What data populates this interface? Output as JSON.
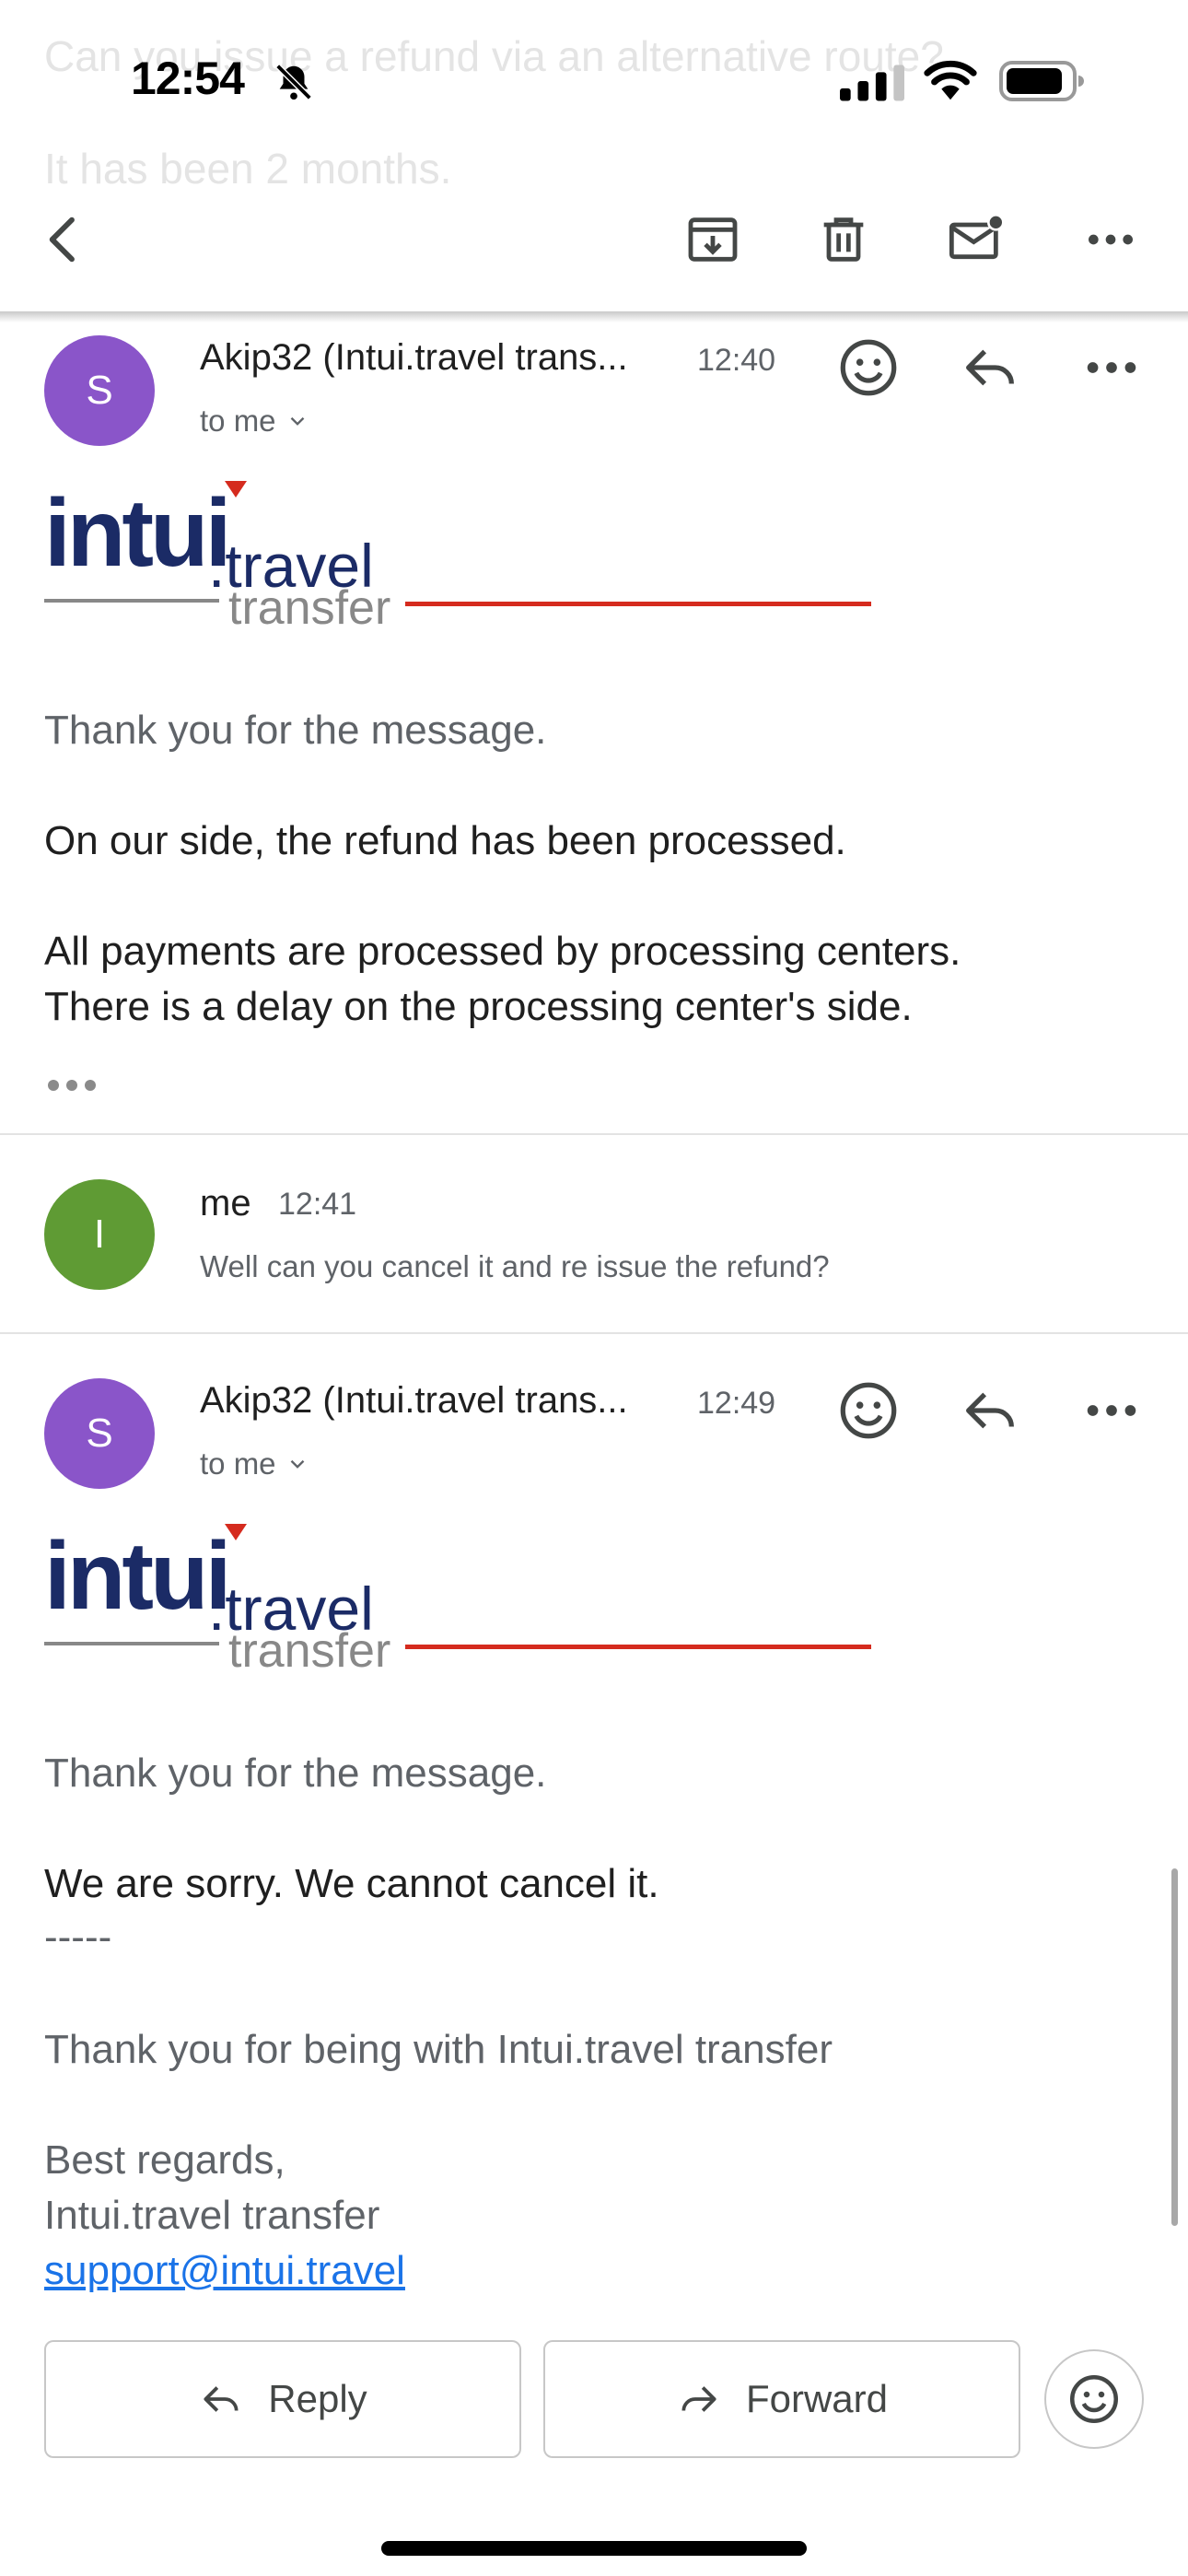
{
  "background_text": {
    "line1": "Can you issue a refund via an alternative route?",
    "line2": "It has been 2 months."
  },
  "status_bar": {
    "time": "12:54"
  },
  "messages": [
    {
      "avatar_letter": "S",
      "avatar_color": "#8a55c9",
      "sender": "Akip32 (Intui.travel trans...",
      "time": "12:40",
      "recipient": "to me",
      "logo": {
        "main": "intui",
        "dot_travel": ".travel",
        "sub": "transfer"
      },
      "greeting": "Thank you for the message.",
      "paragraphs": [
        "On our side, the refund has been processed.",
        "All payments are processed by processing centers.",
        "There is a delay on the processing center's side."
      ]
    },
    {
      "avatar_letter": "I",
      "avatar_color": "#5f9b34",
      "sender": "me",
      "time": "12:41",
      "snippet": "Well can you cancel it and re issue the refund?"
    },
    {
      "avatar_letter": "S",
      "avatar_color": "#8a55c9",
      "sender": "Akip32 (Intui.travel trans...",
      "time": "12:49",
      "recipient": "to me",
      "logo": {
        "main": "intui",
        "dot_travel": ".travel",
        "sub": "transfer"
      },
      "greeting": "Thank you for the message.",
      "reply": "We are sorry. We cannot cancel it.",
      "separator": "-----",
      "thanks": "Thank you for being with Intui.travel transfer",
      "sign_off": "Best regards,",
      "signature": "Intui.travel transfer",
      "email": "support@intui.travel"
    }
  ],
  "actions": {
    "reply": "Reply",
    "forward": "Forward"
  },
  "icons": [
    "bell-slash-icon",
    "signal-icon",
    "wifi-icon",
    "battery-icon",
    "back-icon",
    "archive-icon",
    "trash-icon",
    "mark-unread-icon",
    "more-icon",
    "emoji-icon",
    "reply-icon",
    "forward-icon"
  ]
}
